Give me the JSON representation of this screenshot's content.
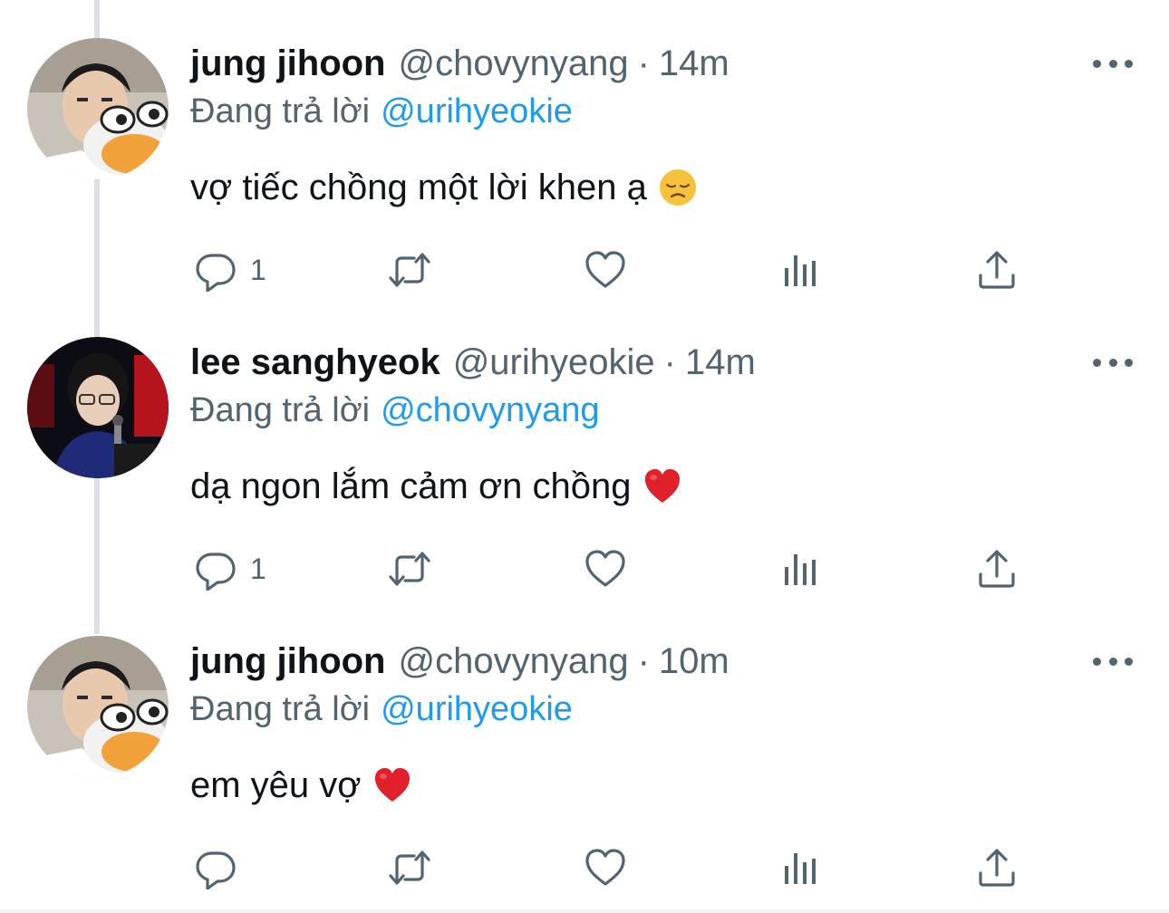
{
  "colors": {
    "text_primary": "#0f1419",
    "text_secondary": "#536471",
    "link": "#1d9bf0",
    "thread_line": "#dcdfe3"
  },
  "tweets": [
    {
      "name": "jung jihoon",
      "handle": "@chovynyang",
      "separator": "·",
      "time": "14m",
      "reply_prefix": "Đang trả lời",
      "reply_handle": "@urihyeokie",
      "text": "vợ tiếc chồng một lời khen ạ",
      "emoji": "disappointed-face-emoji",
      "avatar": "avatar-man-with-plush",
      "reply_count": "1"
    },
    {
      "name": "lee sanghyeok",
      "handle": "@urihyeokie",
      "separator": "·",
      "time": "14m",
      "reply_prefix": "Đang trả lời",
      "reply_handle": "@chovynyang",
      "text": "dạ ngon lắm cảm ơn chồng",
      "emoji": "red-heart-emoji",
      "avatar": "avatar-man-on-stage",
      "reply_count": "1"
    },
    {
      "name": "jung jihoon",
      "handle": "@chovynyang",
      "separator": "·",
      "time": "10m",
      "reply_prefix": "Đang trả lời",
      "reply_handle": "@urihyeokie",
      "text": "em yêu vợ",
      "emoji": "red-heart-emoji",
      "avatar": "avatar-man-with-plush",
      "reply_count": ""
    }
  ],
  "icons": {
    "reply": "reply-icon",
    "retweet": "retweet-icon",
    "like": "heart-icon",
    "views": "bar-chart-icon",
    "share": "share-icon",
    "more": "more-dots-icon"
  }
}
